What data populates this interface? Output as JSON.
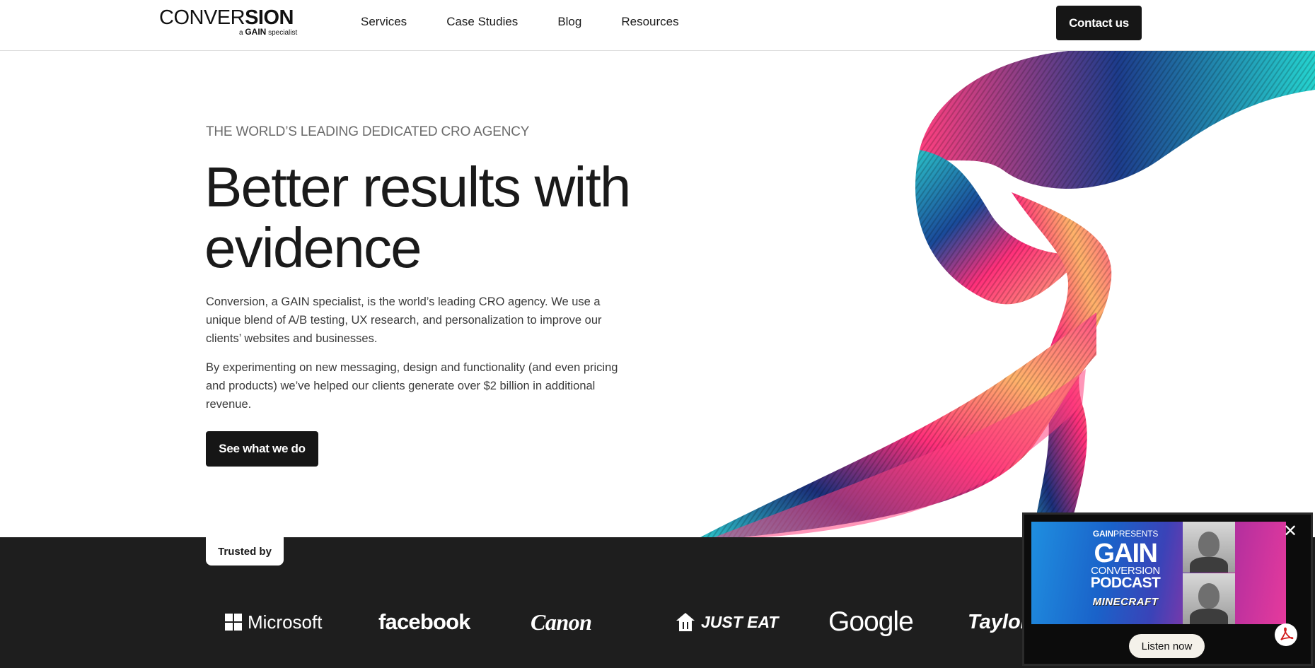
{
  "header": {
    "logo": {
      "main_thin": "CONVER",
      "main_bold": "SION",
      "sub_prefix": "a",
      "sub_brand": "GAIN",
      "sub_suffix": "specialist"
    },
    "nav": [
      {
        "label": "Services"
      },
      {
        "label": "Case Studies"
      },
      {
        "label": "Blog"
      },
      {
        "label": "Resources"
      }
    ],
    "contact_label": "Contact us"
  },
  "hero": {
    "eyebrow": "THE WORLD’S LEADING DEDICATED CRO AGENCY",
    "headline": "Better results with evidence",
    "paragraph1": "Conversion, a GAIN specialist, is the world’s leading CRO agency. We use a unique blend of A/B testing, UX research, and personalization to improve our clients’ websites and businesses.",
    "paragraph2": "By experimenting on new messaging, design and functionality (and even pricing and products) we’ve helped our clients generate over $2 billion in additional revenue.",
    "cta_label": "See what we do"
  },
  "trusted": {
    "tab_label": "Trusted by",
    "logos": [
      "Microsoft",
      "facebook",
      "Canon",
      "JUST EAT",
      "Google",
      "Taylor"
    ]
  },
  "podcast_popup": {
    "presents_brand": "GAIN",
    "presents_word": "PRESENTS",
    "title_big": "GAIN",
    "title_conv": "CONVERSION",
    "title_podcast": "PODCAST",
    "guest_brand": "MINECRAFT",
    "close_icon": "close-icon",
    "listen_label": "Listen now",
    "badge_icon": "pdf-icon"
  },
  "colors": {
    "ink": "#161616",
    "band": "#1e1e1e",
    "ribbon_teal": "#2bc2c8",
    "ribbon_pink": "#ff2f7a",
    "ribbon_orange": "#ffb36a",
    "ribbon_navy": "#1b2f7a"
  }
}
